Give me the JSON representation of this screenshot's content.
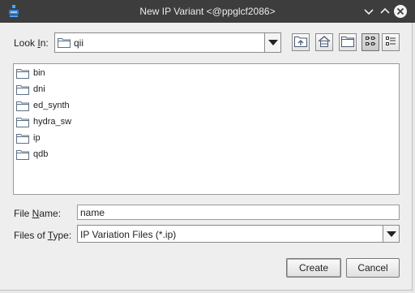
{
  "window": {
    "title": "New IP Variant <@ppglcf2086>",
    "app_icon": "app-logo-icon",
    "controls": [
      "chevron-down-icon",
      "chevron-up-icon",
      "close-icon"
    ]
  },
  "look_in": {
    "label_prefix": "Look ",
    "label_mnemonic": "I",
    "label_suffix": "n:",
    "value": "qii",
    "value_icon": "folder-icon"
  },
  "toolbar": {
    "buttons": [
      {
        "name": "up-one-level",
        "icon": "folder-up-icon"
      },
      {
        "name": "home",
        "icon": "home-icon"
      },
      {
        "name": "new-folder",
        "icon": "new-folder-icon"
      },
      {
        "name": "list-view",
        "icon": "list-view-icon",
        "active": true
      },
      {
        "name": "details-view",
        "icon": "details-view-icon",
        "active": false
      }
    ]
  },
  "files": [
    {
      "name": "bin",
      "icon": "folder-icon"
    },
    {
      "name": "dni",
      "icon": "folder-icon"
    },
    {
      "name": "ed_synth",
      "icon": "folder-icon"
    },
    {
      "name": "hydra_sw",
      "icon": "folder-icon"
    },
    {
      "name": "ip",
      "icon": "folder-icon"
    },
    {
      "name": "qdb",
      "icon": "folder-icon"
    }
  ],
  "file_name": {
    "label_prefix": "File ",
    "label_mnemonic": "N",
    "label_suffix": "ame:",
    "value": "name"
  },
  "file_type": {
    "label_prefix": "Files of ",
    "label_mnemonic": "T",
    "label_suffix": "ype:",
    "value": "IP Variation Files (*.ip)"
  },
  "buttons": {
    "create": "Create",
    "cancel": "Cancel"
  },
  "colors": {
    "titlebar": "#3d3d3d",
    "background": "#eeeeee",
    "folder": "#5d6f86"
  }
}
